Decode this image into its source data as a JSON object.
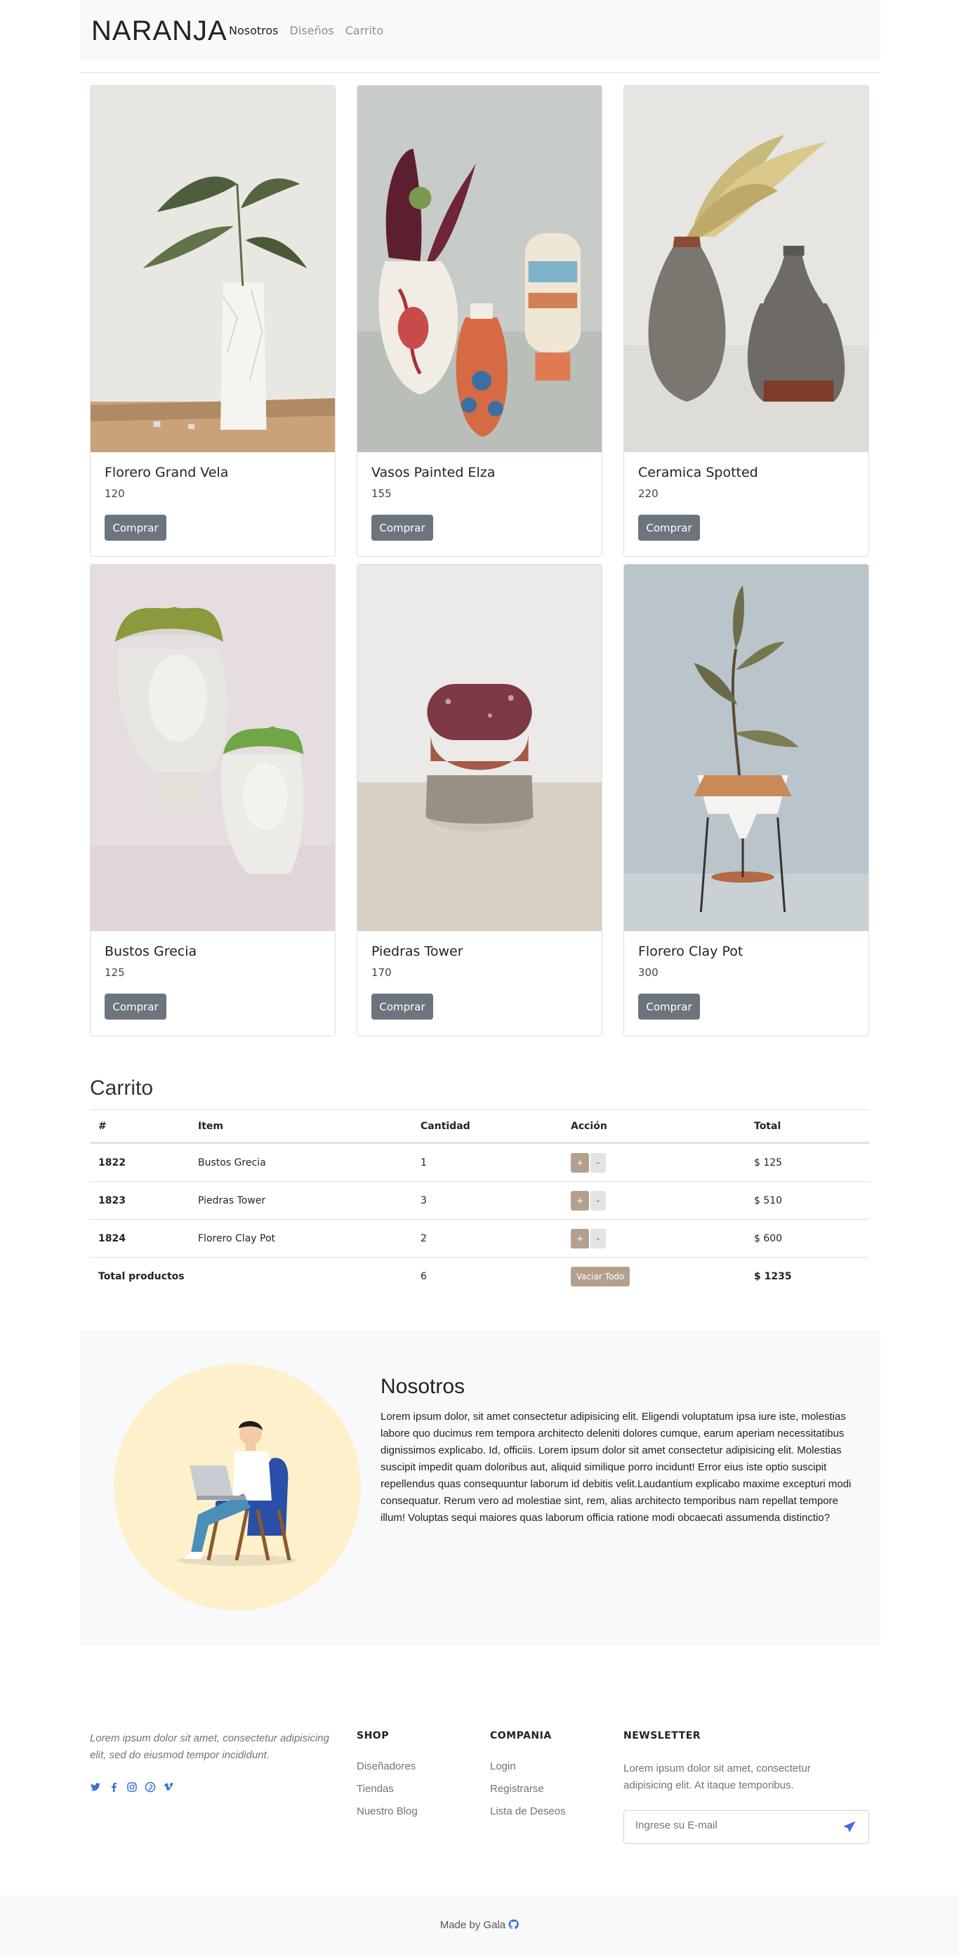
{
  "brand": "NARANJA",
  "nav": [
    {
      "label": "Nosotros",
      "active": true
    },
    {
      "label": "Diseños",
      "active": false
    },
    {
      "label": "Carrito",
      "active": false
    }
  ],
  "products": [
    {
      "name": "Florero Grand Vela",
      "price": "120",
      "button": "Comprar",
      "image": "white-vase-plant"
    },
    {
      "name": "Vasos Painted Elza",
      "price": "155",
      "button": "Comprar",
      "image": "painted-vases"
    },
    {
      "name": "Ceramica Spotted",
      "price": "220",
      "button": "Comprar",
      "image": "spotted-ceramic-vases"
    },
    {
      "name": "Bustos Grecia",
      "price": "125",
      "button": "Comprar",
      "image": "greek-bust-planters"
    },
    {
      "name": "Piedras Tower",
      "price": "170",
      "button": "Comprar",
      "image": "stone-tower-sculpture"
    },
    {
      "name": "Florero Clay Pot",
      "price": "300",
      "button": "Comprar",
      "image": "clay-pot-stand"
    }
  ],
  "cart": {
    "title": "Carrito",
    "headers": [
      "#",
      "Item",
      "Cantidad",
      "Acción",
      "Total"
    ],
    "rows": [
      {
        "id": "1822",
        "item": "Bustos Grecia",
        "qty": "1",
        "plus": "+",
        "minus": "-",
        "total": "$ 125"
      },
      {
        "id": "1823",
        "item": "Piedras Tower",
        "qty": "3",
        "plus": "+",
        "minus": "-",
        "total": "$ 510"
      },
      {
        "id": "1824",
        "item": "Florero Clay Pot",
        "qty": "2",
        "plus": "+",
        "minus": "-",
        "total": "$ 600"
      }
    ],
    "footer": {
      "label": "Total productos",
      "qty": "6",
      "clear": "Vaciar Todo",
      "total": "$ 1235"
    }
  },
  "about": {
    "title": "Nosotros",
    "text": "Lorem ipsum dolor, sit amet consectetur adipisicing elit. Eligendi voluptatum ipsa iure iste, molestias labore quo ducimus rem tempora architecto deleniti dolores cumque, earum aperiam necessitatibus dignissimos explicabo. Id, officiis. Lorem ipsum dolor sit amet consectetur adipisicing elit. Molestias suscipit impedit quam doloribus aut, aliquid similique porro incidunt! Error eius iste optio suscipit repellendus quas consequuntur laborum id debitis velit.Laudantium explicabo maxime excepturi modi consequatur. Rerum vero ad molestiae sint, rem, alias architecto temporibus nam repellat tempore illum! Voluptas sequi maiores quas laborum officia ratione modi obcaecati assumenda distinctio?"
  },
  "footer": {
    "tagline": "Lorem ipsum dolor sit amet, consectetur adipisicing elit, sed do eiusmod tempor incididunt.",
    "socials": [
      "twitter-icon",
      "facebook-icon",
      "instagram-icon",
      "pinterest-icon",
      "vimeo-icon"
    ],
    "shop": {
      "title": "SHOP",
      "links": [
        "Diseñadores",
        "Tiendas",
        "Nuestro Blog"
      ]
    },
    "company": {
      "title": "COMPANIA",
      "links": [
        "Login",
        "Registrarse",
        "Lista de Deseos"
      ]
    },
    "newsletter": {
      "title": "NEWSLETTER",
      "text": "Lorem ipsum dolor sit amet, consectetur adipisicing elit. At itaque temporibus.",
      "placeholder": "Ingrese su E-mail"
    },
    "made_by": "Made by Gala",
    "colors": {
      "accent": "#b5a08f",
      "button": "#6c757d",
      "social": "#3b6fd8"
    }
  }
}
